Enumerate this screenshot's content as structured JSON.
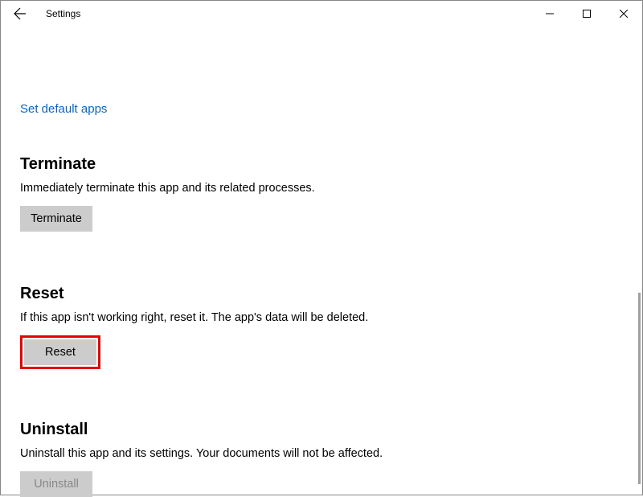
{
  "window": {
    "title": "Settings"
  },
  "link": {
    "set_default_apps": "Set default apps"
  },
  "sections": {
    "terminate": {
      "title": "Terminate",
      "description": "Immediately terminate this app and its related processes.",
      "button_label": "Terminate"
    },
    "reset": {
      "title": "Reset",
      "description": "If this app isn't working right, reset it. The app's data will be deleted.",
      "button_label": "Reset"
    },
    "uninstall": {
      "title": "Uninstall",
      "description": "Uninstall this app and its settings. Your documents will not be affected.",
      "button_label": "Uninstall"
    }
  }
}
